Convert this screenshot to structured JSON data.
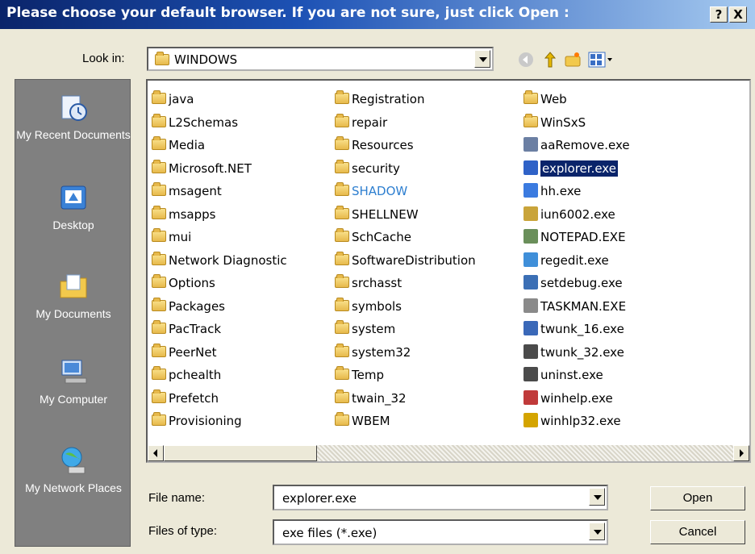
{
  "dialog": {
    "title": "Please choose your default browser. If you are not sure, just click Open :",
    "help_label": "?",
    "close_label": "X"
  },
  "look_in": {
    "label": "Look in:",
    "value": "WINDOWS"
  },
  "places": [
    {
      "label": "My Recent Documents",
      "icon": "recent-documents-icon"
    },
    {
      "label": "Desktop",
      "icon": "desktop-icon"
    },
    {
      "label": "My Documents",
      "icon": "my-documents-icon"
    },
    {
      "label": "My Computer",
      "icon": "my-computer-icon"
    },
    {
      "label": "My Network Places",
      "icon": "network-places-icon"
    }
  ],
  "files": {
    "col1": [
      "java",
      "L2Schemas",
      "Media",
      "Microsoft.NET",
      "msagent",
      "msapps",
      "mui",
      "Network Diagnostic",
      "Options",
      "Packages",
      "PacTrack",
      "PeerNet",
      "pchealth",
      "Prefetch",
      "Provisioning"
    ],
    "col2": [
      "Registration",
      "repair",
      "Resources",
      "security",
      "SHADOW",
      "SHELLNEW",
      "SchCache",
      "SoftwareDistribution",
      "srchasst",
      "symbols",
      "system",
      "system32",
      "Temp",
      "twain_32",
      "WBEM"
    ],
    "col3": [
      "Web",
      "WinSxS",
      "aaRemove.exe",
      "explorer.exe",
      "hh.exe",
      "iun6002.exe",
      "NOTEPAD.EXE",
      "regedit.exe",
      "setdebug.exe",
      "TASKMAN.EXE",
      "twunk_16.exe",
      "twunk_32.exe",
      "uninst.exe",
      "winhelp.exe",
      "winhlp32.exe"
    ],
    "selected": "explorer.exe",
    "highlight_color": "#2e7fd0"
  },
  "file_name": {
    "label": "File name:",
    "value": "explorer.exe"
  },
  "file_type": {
    "label": "Files of type:",
    "value": "exe files (*.exe)"
  },
  "buttons": {
    "open": "Open",
    "cancel": "Cancel"
  }
}
